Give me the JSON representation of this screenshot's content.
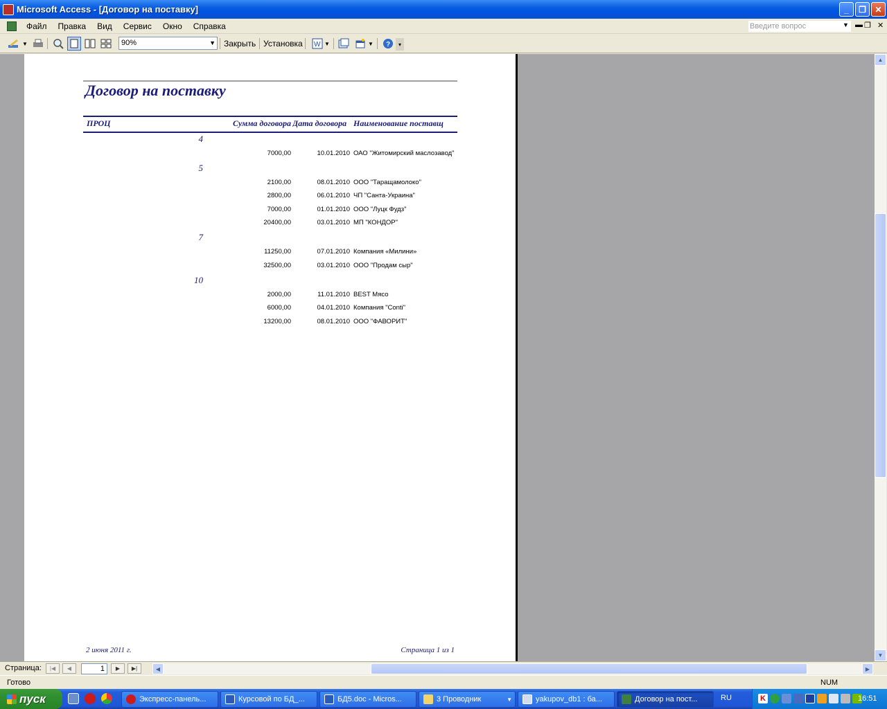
{
  "window": {
    "title": "Microsoft Access - [Договор на поставку]"
  },
  "menu": {
    "items": [
      "Файл",
      "Правка",
      "Вид",
      "Сервис",
      "Окно",
      "Справка"
    ],
    "ask_placeholder": "Введите вопрос"
  },
  "toolbar": {
    "zoom_value": "90%",
    "close_label": "Закрыть",
    "setup_label": "Установка"
  },
  "report": {
    "title": "Договор на поставку",
    "columns": [
      "ПРОЦ",
      "Сумма договора",
      "Дата договора",
      "Наименование поставщ"
    ],
    "groups": [
      {
        "key": "4",
        "rows": [
          {
            "sum": "7000,00",
            "date": "10.01.2010",
            "name": "ОАО \"Житомирский маслозавод\""
          }
        ]
      },
      {
        "key": "5",
        "rows": [
          {
            "sum": "2100,00",
            "date": "08.01.2010",
            "name": "ООО \"Таращамолоко\""
          },
          {
            "sum": "2800,00",
            "date": "06.01.2010",
            "name": "ЧП \"Санта-Украина\""
          },
          {
            "sum": "7000,00",
            "date": "01.01.2010",
            "name": "ООО \"Луцк Фудз\""
          },
          {
            "sum": "20400,00",
            "date": "03.01.2010",
            "name": "МП \"КОНДОР\""
          }
        ]
      },
      {
        "key": "7",
        "rows": [
          {
            "sum": "11250,00",
            "date": "07.01.2010",
            "name": "Компания «Милини»"
          },
          {
            "sum": "32500,00",
            "date": "03.01.2010",
            "name": "ООО \"Продам сыр\""
          }
        ]
      },
      {
        "key": "10",
        "rows": [
          {
            "sum": "2000,00",
            "date": "11.01.2010",
            "name": "BEST Мясо"
          },
          {
            "sum": "6000,00",
            "date": "04.01.2010",
            "name": "Компания \"Conti\""
          },
          {
            "sum": "13200,00",
            "date": "08.01.2010",
            "name": "ООО \"ФАВОРИТ\""
          }
        ]
      }
    ],
    "footer_date": "2 июня 2011 г.",
    "footer_page": "Страница 1 из 1"
  },
  "navigation": {
    "label": "Страница:",
    "page_value": "1"
  },
  "status": {
    "text": "Готово",
    "num": "NUM"
  },
  "taskbar": {
    "start_label": "пуск",
    "tasks": [
      "Экспресс-панель...",
      "Курсовой по БД_...",
      "БД5.doc - Micros...",
      "3 Проводник",
      "yakupov_db1 : ба...",
      "Договор на пост..."
    ],
    "lang": "RU",
    "clock": "16:51"
  }
}
